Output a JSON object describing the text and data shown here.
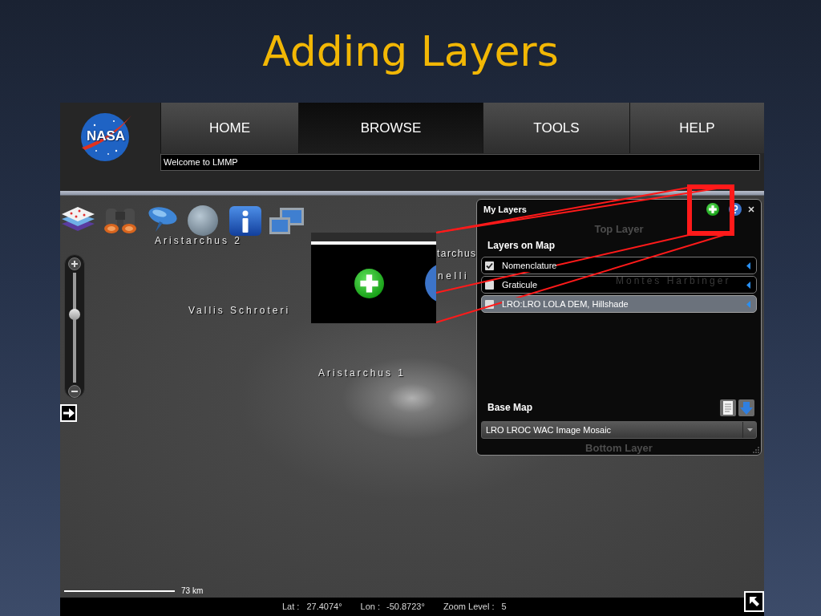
{
  "slide": {
    "title": "Adding Layers"
  },
  "app": {
    "logo": {
      "text": "NASA"
    },
    "nav_tabs": [
      {
        "label": "HOME",
        "selected": false
      },
      {
        "label": "BROWSE",
        "selected": true
      },
      {
        "label": "TOOLS",
        "selected": false
      },
      {
        "label": "HELP",
        "selected": false
      }
    ],
    "message_bar": {
      "text": "Welcome to LMMP"
    },
    "map": {
      "labels": [
        "Aristarchus 2",
        "tarchus",
        "nelli",
        "Vallis Schroteri",
        "Aristarchus 1"
      ],
      "zoom_slider": {
        "level": 0.64
      },
      "scale": "73 km"
    },
    "layers_panel": {
      "title": "My Layers",
      "top_label": "Top Layer",
      "section_title": "Layers on Map",
      "layers": [
        {
          "name": "Nomenclature",
          "checked": true,
          "selected": false
        },
        {
          "name": "Graticule",
          "checked": false,
          "selected": false
        },
        {
          "name": "LRO:LRO LOLA DEM, Hillshade",
          "checked": false,
          "selected": true
        }
      ],
      "label_showing_through": "Montes Harbinger",
      "base_map_title": "Base Map",
      "base_map": {
        "value": "LRO LROC WAC Image Mosaic"
      },
      "bottom_label": "Bottom Layer"
    },
    "status_bar": {
      "lat_label": "Lat :",
      "lat": "27.4074°",
      "lon_label": "Lon :",
      "lon": "-50.8723°",
      "zoom_label": "Zoom Level :",
      "zoom": "5"
    }
  }
}
